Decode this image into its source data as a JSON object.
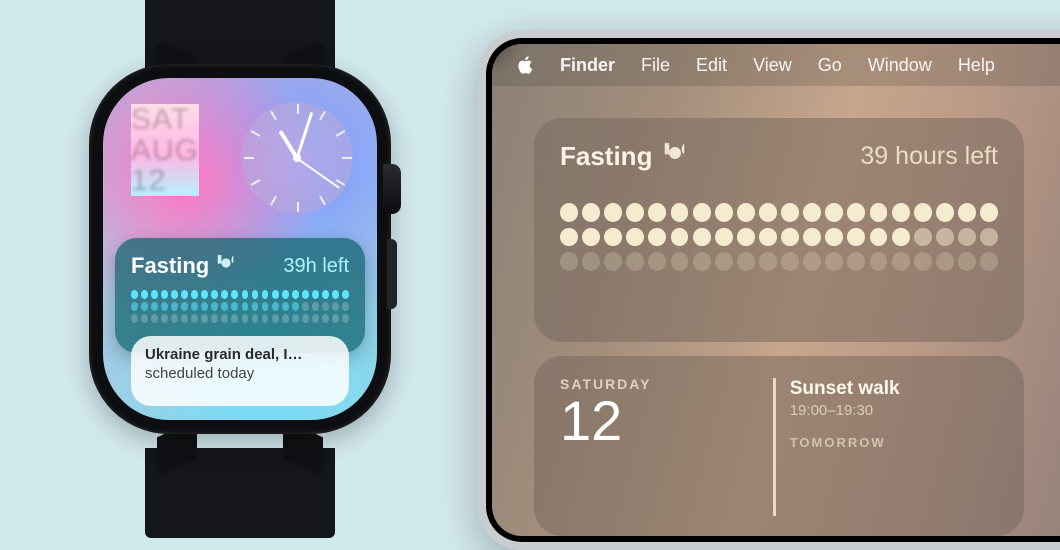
{
  "watch": {
    "date": {
      "dow": "SAT",
      "mon": "AUG",
      "day": "12"
    },
    "widget": {
      "title": "Fasting",
      "time_left": "39h left",
      "dot_rows": [
        {
          "cols": 22,
          "fill": 22,
          "style": "on"
        },
        {
          "cols": 22,
          "fill": 17,
          "style": "half",
          "rest": "off"
        },
        {
          "cols": 22,
          "fill": 0,
          "style": "off",
          "rest": "off"
        }
      ]
    },
    "peek": {
      "line1": "Ukraine grain deal, I…",
      "line2": "scheduled today"
    }
  },
  "ipad": {
    "menubar": {
      "app": "Finder",
      "items": [
        "File",
        "Edit",
        "View",
        "Go",
        "Window",
        "Help"
      ]
    },
    "widget": {
      "title": "Fasting",
      "time_left": "39 hours left",
      "dot_rows": [
        {
          "cols": 20,
          "fill": 20,
          "style": "on"
        },
        {
          "cols": 20,
          "fill": 16,
          "style": "on",
          "rest": "half"
        },
        {
          "cols": 20,
          "fill": 0,
          "style": "off",
          "rest": "off"
        }
      ]
    },
    "calendar": {
      "day_label": "SATURDAY",
      "day_num": "12",
      "event_title": "Sunset walk",
      "event_time": "19:00–19:30",
      "tomorrow_label": "TOMORROW"
    }
  }
}
